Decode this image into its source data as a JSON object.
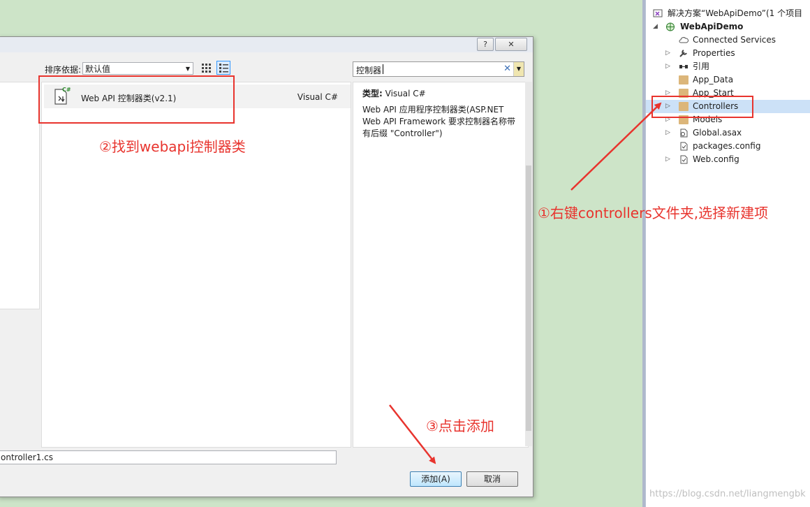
{
  "dialog": {
    "help_label": "?",
    "close_label": "✕",
    "sort_label": "排序依据:",
    "sort_value": "默认值",
    "search_value": "控制器",
    "template": {
      "name": "Web API 控制器类(v2.1)",
      "lang": "Visual C#",
      "badge": "C#"
    },
    "detail": {
      "type_label": "类型:",
      "type_value": "Visual C#",
      "description": "Web API 应用程序控制器类(ASP.NET Web API Framework 要求控制器名称带有后缀 \"Controller\")"
    },
    "name_field_value": "ontroller1.cs",
    "add_button": "添加(A)",
    "cancel_button": "取消"
  },
  "explorer": {
    "solution": "解决方案“WebApiDemo”(1 个项目",
    "project": "WebApiDemo",
    "items": [
      "Connected Services",
      "Properties",
      "引用",
      "App_Data",
      "App_Start",
      "Controllers",
      "Models",
      "Global.asax",
      "packages.config",
      "Web.config"
    ]
  },
  "annotations": {
    "step1": "①右键controllers文件夹,选择新建项",
    "step2": "②找到webapi控制器类",
    "step3": "③点击添加"
  },
  "watermark": "https://blog.csdn.net/liangmengbk",
  "colors": {
    "annotation": "#e8342e",
    "selection": "#cce1f7",
    "folder": "#dcb67a"
  }
}
